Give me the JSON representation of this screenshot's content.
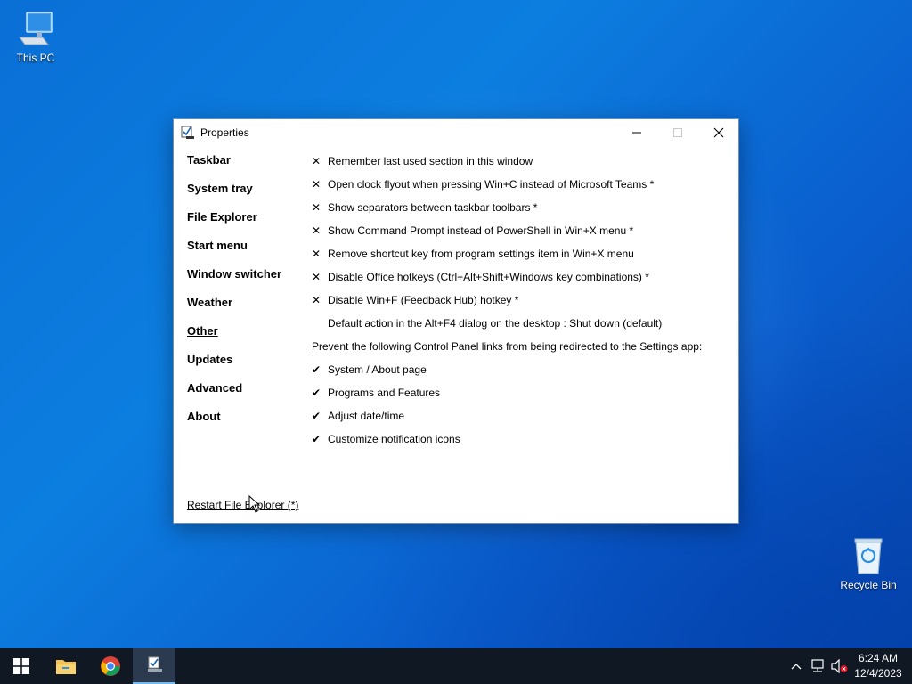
{
  "desktop": {
    "icons": [
      {
        "label": "This PC"
      },
      {
        "label": "Recycle Bin"
      }
    ]
  },
  "window": {
    "title": "Properties",
    "sidebar": [
      {
        "label": "Taskbar"
      },
      {
        "label": "System tray"
      },
      {
        "label": "File Explorer"
      },
      {
        "label": "Start menu"
      },
      {
        "label": "Window switcher"
      },
      {
        "label": "Weather"
      },
      {
        "label": "Other",
        "active": true
      },
      {
        "label": "Updates"
      },
      {
        "label": "Advanced"
      },
      {
        "label": "About"
      }
    ],
    "options": [
      {
        "mark": "✕",
        "label": "Remember last used section in this window"
      },
      {
        "mark": "✕",
        "label": "Open clock flyout when pressing Win+C instead of Microsoft Teams *"
      },
      {
        "mark": "✕",
        "label": "Show separators between taskbar toolbars *"
      },
      {
        "mark": "✕",
        "label": "Show Command Prompt instead of PowerShell in Win+X menu *"
      },
      {
        "mark": "✕",
        "label": "Remove shortcut key from program settings item in Win+X menu"
      },
      {
        "mark": "✕",
        "label": "Disable Office hotkeys (Ctrl+Alt+Shift+Windows key combinations) *"
      },
      {
        "mark": "✕",
        "label": "Disable Win+F (Feedback Hub) hotkey *"
      },
      {
        "mark": "",
        "label": "Default action in the Alt+F4 dialog on the desktop : Shut down (default)"
      },
      {
        "heading": true,
        "label": "Prevent the following Control Panel links from being redirected to the Settings app:"
      },
      {
        "mark": "✔",
        "label": "System / About page"
      },
      {
        "mark": "✔",
        "label": "Programs and Features"
      },
      {
        "mark": "✔",
        "label": "Adjust date/time"
      },
      {
        "mark": "✔",
        "label": "Customize notification icons"
      }
    ],
    "restart_link": "Restart File Explorer (*)"
  },
  "taskbar": {
    "clock_time": "6:24 AM",
    "clock_date": "12/4/2023"
  }
}
